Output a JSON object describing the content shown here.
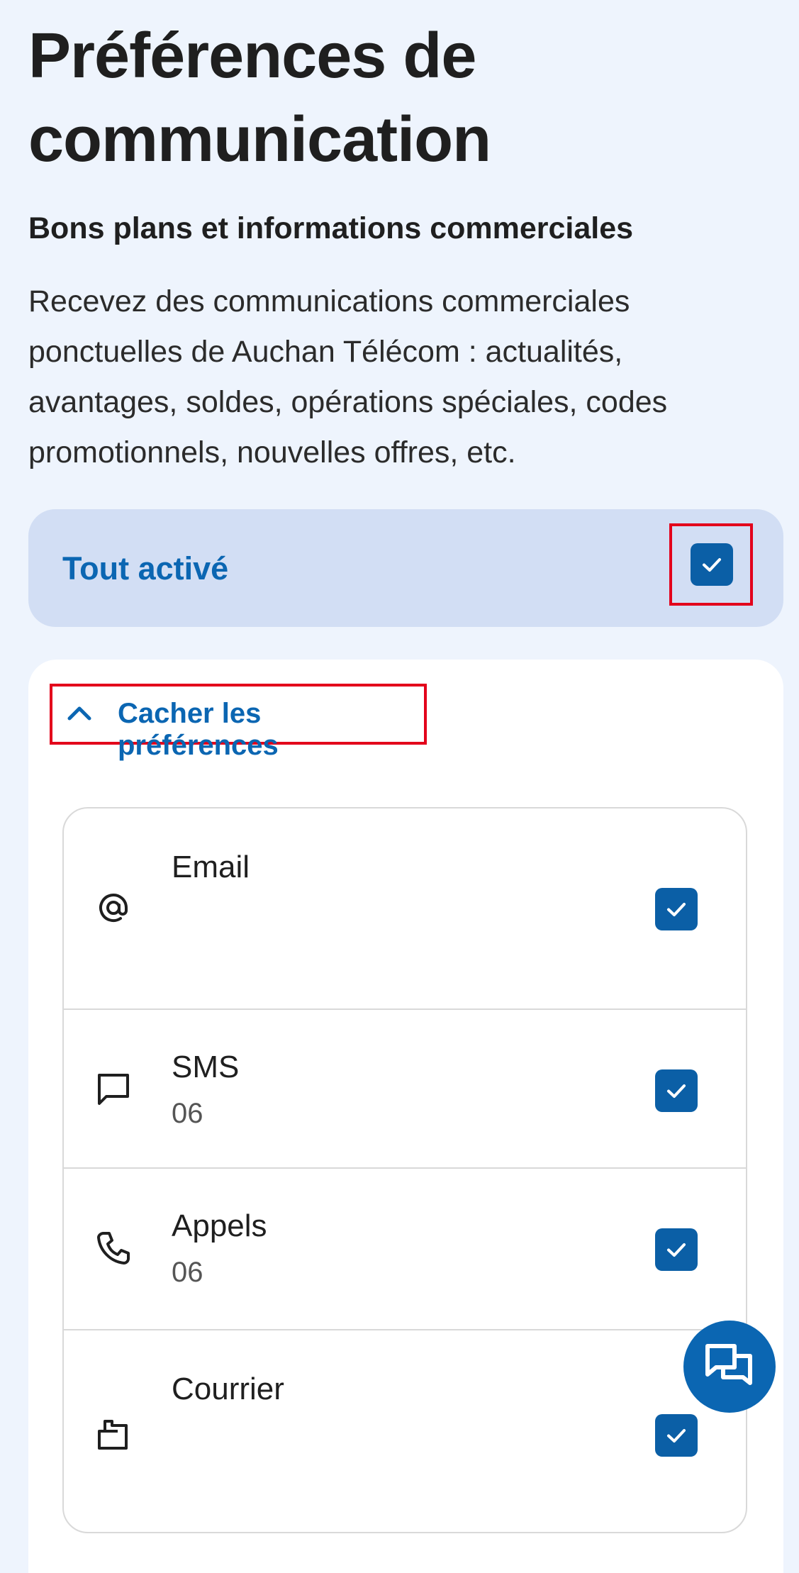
{
  "page": {
    "title": "Préférences de communication"
  },
  "section": {
    "title": "Bons plans et informations commerciales",
    "description": "Recevez des communications commerciales ponctuelles de Auchan Télécom : actualités, avantages, soldes, opérations spéciales, codes promotionnels, nouvelles offres, etc."
  },
  "toggle_all": {
    "label": "Tout activé",
    "checked": true
  },
  "preferences_toggle": {
    "label": "Cacher les préférences",
    "icon": "chevron-up-icon"
  },
  "channels": [
    {
      "title": "Email",
      "subtitle": "",
      "icon": "at-sign-icon",
      "checked": true
    },
    {
      "title": "SMS",
      "subtitle": "06",
      "icon": "message-icon",
      "checked": true
    },
    {
      "title": "Appels",
      "subtitle": "06",
      "icon": "phone-icon",
      "checked": true
    },
    {
      "title": "Courrier",
      "subtitle": "",
      "icon": "mailbox-icon",
      "checked": true
    }
  ],
  "colors": {
    "accent": "#0b66b2",
    "checkbox": "#0b5fa6",
    "toggle_bg": "#d2def4",
    "highlight": "#e3001b",
    "page_bg": "#eef4fd"
  },
  "chat_button": {
    "icon": "chat-icon"
  }
}
